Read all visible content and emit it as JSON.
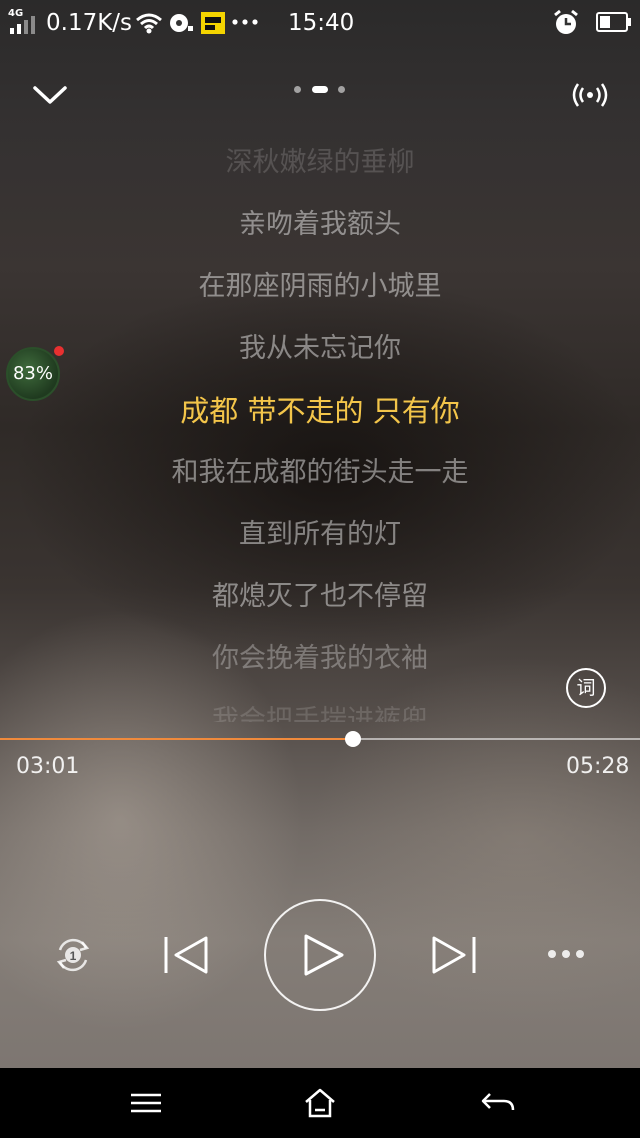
{
  "status_bar": {
    "network_type": "4G",
    "speed": "0.17K/s",
    "time": "15:40",
    "icons": [
      "signal-icon",
      "wifi-icon",
      "media-icon",
      "app-notification-icon",
      "more-dots-icon",
      "alarm-icon",
      "battery-icon"
    ]
  },
  "player": {
    "top_bar": {
      "collapse_icon": "chevron-down-icon",
      "page_count": 3,
      "active_page": 2,
      "cast_icon": "broadcast-icon"
    },
    "lyrics": [
      "深秋嫩绿的垂柳",
      "亲吻着我额头",
      "在那座阴雨的小城里",
      "我从未忘记你",
      "成都 带不走的 只有你",
      "和我在成都的街头走一走",
      "直到所有的灯",
      "都熄灭了也不停留",
      "你会挽着我的衣袖",
      "我会把手揣进裤兜"
    ],
    "current_line_index": 4,
    "boost_badge": "83%",
    "lyric_toggle": "词",
    "progress": {
      "elapsed": "03:01",
      "total": "05:28",
      "fraction": 0.5518
    },
    "controls": {
      "repeat_icon": "repeat-one-icon",
      "prev_icon": "skip-previous-icon",
      "play_icon": "play-icon",
      "next_icon": "skip-next-icon",
      "more_icon": "more-horizontal-icon"
    },
    "colors": {
      "accent_lyric": "#f3c54a",
      "progress": "#f08a3c"
    }
  },
  "nav_bar": {
    "icons": [
      "menu-icon",
      "home-icon",
      "back-icon"
    ]
  }
}
